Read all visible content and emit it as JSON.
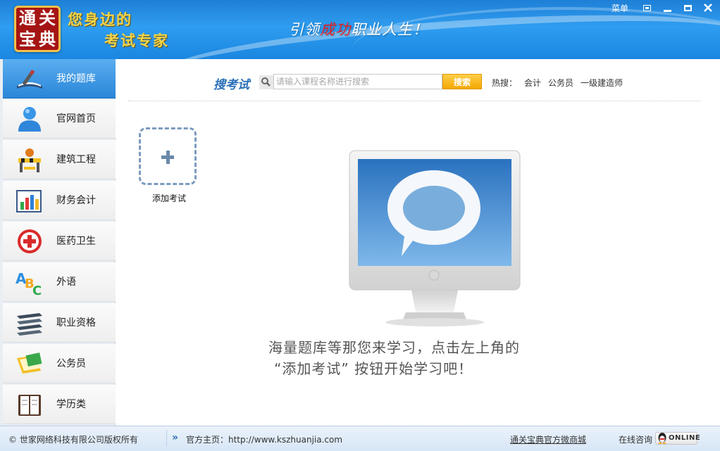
{
  "header": {
    "logo_chars": [
      "通",
      "关",
      "宝",
      "典"
    ],
    "slogan_line1": "您身边的",
    "slogan_line2": "考试专家",
    "tagline_part1": "引领",
    "tagline_part2": "成功",
    "tagline_part3": "职业人生！",
    "menu_label": "菜单",
    "window_buttons": [
      "skin-icon",
      "minimize-icon",
      "maximize-icon",
      "close-icon"
    ]
  },
  "sidebar": {
    "items": [
      {
        "label": "我的题库",
        "icon": "my-library-icon",
        "active": true
      },
      {
        "label": "官网首页",
        "icon": "user-icon",
        "active": false
      },
      {
        "label": "建筑工程",
        "icon": "construction-icon",
        "active": false
      },
      {
        "label": "财务会计",
        "icon": "finance-chart-icon",
        "active": false
      },
      {
        "label": "医药卫生",
        "icon": "medical-cross-icon",
        "active": false
      },
      {
        "label": "外语",
        "icon": "abc-icon",
        "active": false
      },
      {
        "label": "职业资格",
        "icon": "book-stack-icon",
        "active": false
      },
      {
        "label": "公务员",
        "icon": "document-icon",
        "active": false
      },
      {
        "label": "学历类",
        "icon": "notebook-icon",
        "active": false
      }
    ]
  },
  "search": {
    "title": "搜考试",
    "placeholder": "请输入课程名称进行搜索",
    "value": "",
    "button_label": "搜索",
    "hot_label": "热搜：",
    "hot_links": [
      "会计",
      "公务员",
      "一级建造师"
    ]
  },
  "main": {
    "add_exam_label": "添加考试",
    "hint_line1": "海量题库等那您来学习，点击左上角的",
    "hint_line2": "“添加考试” 按钮开始学习吧！"
  },
  "footer": {
    "copyright": "© 世家网络科技有限公司版权所有",
    "homepage": "官方主页：http://www.kszhuanjia.com",
    "shop_link": "通关宝典官方微商城",
    "consult_label": "在线咨询",
    "online_label": "ONLINE"
  },
  "colors": {
    "header_blue": "#1e7fd6",
    "active_tab": "#2a86d8",
    "search_button": "#f4a700",
    "logo_red": "#a51414",
    "slogan_gold": "#f2d54a"
  }
}
